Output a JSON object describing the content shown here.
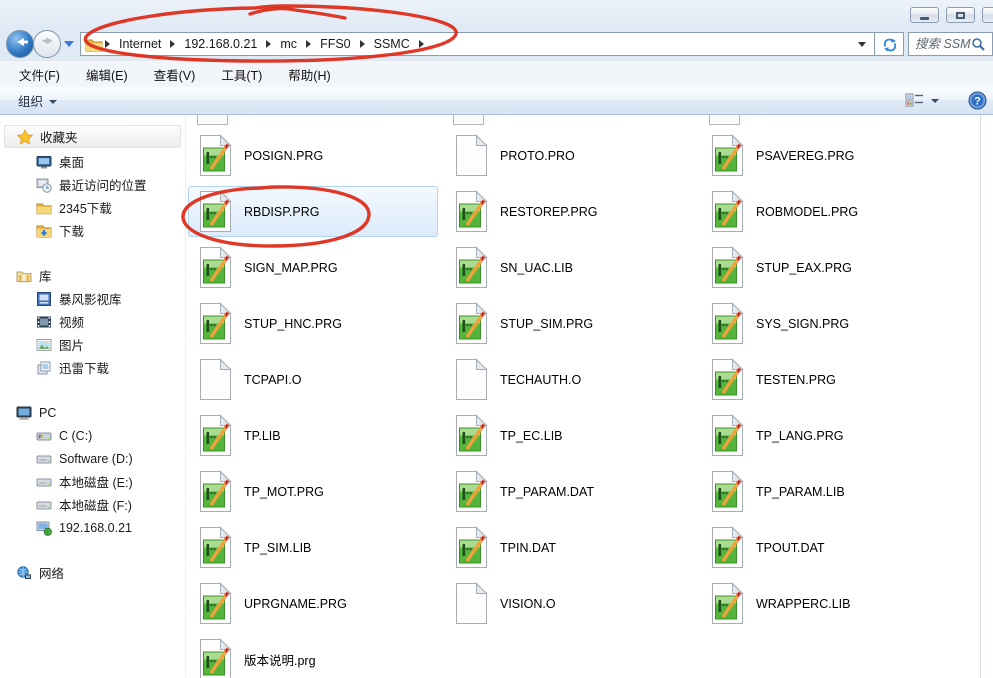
{
  "navbar": {
    "breadcrumb": [
      "Internet",
      "192.168.0.21",
      "mc",
      "FFS0",
      "SSMC"
    ],
    "search_placeholder": "搜索 SSMC"
  },
  "menubar": {
    "items": [
      "文件(F)",
      "编辑(E)",
      "查看(V)",
      "工具(T)",
      "帮助(H)"
    ]
  },
  "toolbar": {
    "organize": "组织"
  },
  "sidebar": {
    "sections": [
      {
        "label": "收藏夹",
        "icon": "star-icon",
        "children": [
          {
            "label": "桌面",
            "icon": "desktop-icon"
          },
          {
            "label": "最近访问的位置",
            "icon": "recent-places-icon"
          },
          {
            "label": "2345下载",
            "icon": "folder-icon"
          },
          {
            "label": "下载",
            "icon": "download-folder-icon"
          }
        ]
      },
      {
        "label": "库",
        "icon": "libraries-icon",
        "children": [
          {
            "label": "暴风影视库",
            "icon": "video-library-icon"
          },
          {
            "label": "视频",
            "icon": "film-icon"
          },
          {
            "label": "图片",
            "icon": "picture-icon"
          },
          {
            "label": "迅雷下载",
            "icon": "thunder-library-icon"
          }
        ]
      },
      {
        "label": "PC",
        "icon": "computer-icon",
        "children": [
          {
            "label": "C (C:)",
            "icon": "system-drive-icon"
          },
          {
            "label": "Software (D:)",
            "icon": "drive-icon"
          },
          {
            "label": "本地磁盘 (E:)",
            "icon": "drive-icon"
          },
          {
            "label": "本地磁盘 (F:)",
            "icon": "drive-icon"
          },
          {
            "label": "192.168.0.21",
            "icon": "network-pc-icon"
          }
        ]
      },
      {
        "label": "网络",
        "icon": "network-icon",
        "children": []
      }
    ]
  },
  "files": {
    "items": [
      {
        "name": "POSIGN.PRG",
        "icon": "prg-file-icon"
      },
      {
        "name": "PROTO.PRO",
        "icon": "plain-file-icon"
      },
      {
        "name": "PSAVEREG.PRG",
        "icon": "prg-file-icon"
      },
      {
        "name": "RBDISP.PRG",
        "icon": "prg-file-icon",
        "selected": true
      },
      {
        "name": "RESTOREP.PRG",
        "icon": "prg-file-icon"
      },
      {
        "name": "ROBMODEL.PRG",
        "icon": "prg-file-icon"
      },
      {
        "name": "SIGN_MAP.PRG",
        "icon": "prg-file-icon"
      },
      {
        "name": "SN_UAC.LIB",
        "icon": "prg-file-icon"
      },
      {
        "name": "STUP_EAX.PRG",
        "icon": "prg-file-icon"
      },
      {
        "name": "STUP_HNC.PRG",
        "icon": "prg-file-icon"
      },
      {
        "name": "STUP_SIM.PRG",
        "icon": "prg-file-icon"
      },
      {
        "name": "SYS_SIGN.PRG",
        "icon": "prg-file-icon"
      },
      {
        "name": "TCPAPI.O",
        "icon": "plain-file-icon"
      },
      {
        "name": "TECHAUTH.O",
        "icon": "plain-file-icon"
      },
      {
        "name": "TESTEN.PRG",
        "icon": "prg-file-icon"
      },
      {
        "name": "TP.LIB",
        "icon": "prg-file-icon"
      },
      {
        "name": "TP_EC.LIB",
        "icon": "prg-file-icon"
      },
      {
        "name": "TP_LANG.PRG",
        "icon": "prg-file-icon"
      },
      {
        "name": "TP_MOT.PRG",
        "icon": "prg-file-icon"
      },
      {
        "name": "TP_PARAM.DAT",
        "icon": "prg-file-icon"
      },
      {
        "name": "TP_PARAM.LIB",
        "icon": "prg-file-icon"
      },
      {
        "name": "TP_SIM.LIB",
        "icon": "prg-file-icon"
      },
      {
        "name": "TPIN.DAT",
        "icon": "prg-file-icon"
      },
      {
        "name": "TPOUT.DAT",
        "icon": "prg-file-icon"
      },
      {
        "name": "UPRGNAME.PRG",
        "icon": "prg-file-icon"
      },
      {
        "name": "VISION.O",
        "icon": "plain-file-icon"
      },
      {
        "name": "WRAPPERC.LIB",
        "icon": "prg-file-icon"
      },
      {
        "name": "版本说明.prg",
        "icon": "prg-file-icon"
      }
    ]
  },
  "annotations": {
    "color": "#dd2d1b",
    "circled": [
      "breadcrumb",
      "RBDISP.PRG"
    ]
  }
}
